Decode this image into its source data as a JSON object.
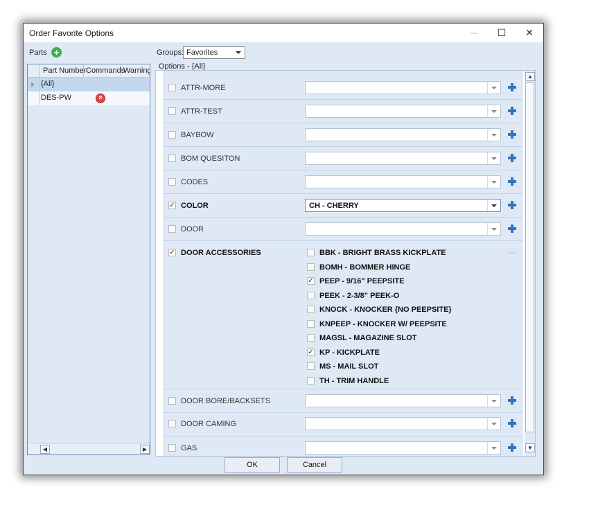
{
  "window": {
    "title": "Order Favorite Options"
  },
  "parts": {
    "label": "Parts",
    "add_icon": "plus-circle-icon",
    "columns": [
      "Part Number",
      "Commands",
      "Warnings"
    ],
    "rows": [
      {
        "part": "{All}",
        "selected": true
      },
      {
        "part": "DES-PW",
        "error_icon": "error-circle-icon"
      }
    ]
  },
  "groups": {
    "label": "Groups:",
    "value": "Favorites"
  },
  "options": {
    "label": "Options - {All}",
    "rows": [
      {
        "name": "ATTR-MORE",
        "checked": false,
        "value": ""
      },
      {
        "name": "ATTR-TEST",
        "checked": false,
        "value": ""
      },
      {
        "name": "BAYBOW",
        "checked": false,
        "value": ""
      },
      {
        "name": "BOM QUESITON",
        "checked": false,
        "value": ""
      },
      {
        "name": "CODES",
        "checked": false,
        "value": ""
      },
      {
        "name": "COLOR",
        "checked": true,
        "value": "CH - CHERRY"
      },
      {
        "name": "DOOR",
        "checked": false,
        "value": ""
      },
      {
        "name": "DOOR ACCESSORIES",
        "checked": true,
        "sub": [
          {
            "label": "BBK - BRIGHT BRASS KICKPLATE",
            "checked": false
          },
          {
            "label": "BOMH - BOMMER HINGE",
            "checked": false
          },
          {
            "label": "PEEP - 9/16\" PEEPSITE",
            "checked": true
          },
          {
            "label": "PEEK - 2-3/8\" PEEK-O",
            "checked": false
          },
          {
            "label": "KNOCK - KNOCKER {NO PEEPSITE}",
            "checked": false
          },
          {
            "label": "KNPEEP - KNOCKER W/ PEEPSITE",
            "checked": false
          },
          {
            "label": "MAGSL - MAGAZINE SLOT",
            "checked": false
          },
          {
            "label": "KP - KICKPLATE",
            "checked": true
          },
          {
            "label": "MS - MAIL SLOT",
            "checked": false
          },
          {
            "label": "TH - TRIM HANDLE",
            "checked": false
          }
        ]
      },
      {
        "name": "DOOR BORE/BACKSETS",
        "checked": false,
        "value": ""
      },
      {
        "name": "DOOR CAMING",
        "checked": false,
        "value": ""
      },
      {
        "name": "GAS",
        "checked": false,
        "value": ""
      }
    ]
  },
  "buttons": {
    "ok": "OK",
    "cancel": "Cancel"
  },
  "window_controls": {
    "minimize": "—",
    "maximize": "☐",
    "close": "✕"
  },
  "check_mark": "✓"
}
